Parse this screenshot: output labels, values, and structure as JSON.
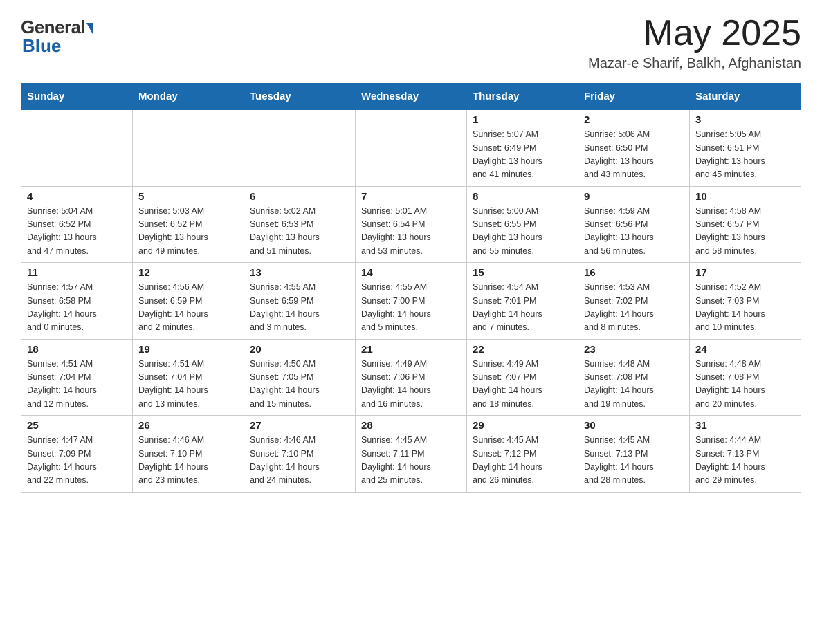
{
  "logo": {
    "general": "General",
    "blue": "Blue"
  },
  "header": {
    "month_year": "May 2025",
    "location": "Mazar-e Sharif, Balkh, Afghanistan"
  },
  "days_of_week": [
    "Sunday",
    "Monday",
    "Tuesday",
    "Wednesday",
    "Thursday",
    "Friday",
    "Saturday"
  ],
  "weeks": [
    [
      {
        "day": "",
        "info": ""
      },
      {
        "day": "",
        "info": ""
      },
      {
        "day": "",
        "info": ""
      },
      {
        "day": "",
        "info": ""
      },
      {
        "day": "1",
        "info": "Sunrise: 5:07 AM\nSunset: 6:49 PM\nDaylight: 13 hours\nand 41 minutes."
      },
      {
        "day": "2",
        "info": "Sunrise: 5:06 AM\nSunset: 6:50 PM\nDaylight: 13 hours\nand 43 minutes."
      },
      {
        "day": "3",
        "info": "Sunrise: 5:05 AM\nSunset: 6:51 PM\nDaylight: 13 hours\nand 45 minutes."
      }
    ],
    [
      {
        "day": "4",
        "info": "Sunrise: 5:04 AM\nSunset: 6:52 PM\nDaylight: 13 hours\nand 47 minutes."
      },
      {
        "day": "5",
        "info": "Sunrise: 5:03 AM\nSunset: 6:52 PM\nDaylight: 13 hours\nand 49 minutes."
      },
      {
        "day": "6",
        "info": "Sunrise: 5:02 AM\nSunset: 6:53 PM\nDaylight: 13 hours\nand 51 minutes."
      },
      {
        "day": "7",
        "info": "Sunrise: 5:01 AM\nSunset: 6:54 PM\nDaylight: 13 hours\nand 53 minutes."
      },
      {
        "day": "8",
        "info": "Sunrise: 5:00 AM\nSunset: 6:55 PM\nDaylight: 13 hours\nand 55 minutes."
      },
      {
        "day": "9",
        "info": "Sunrise: 4:59 AM\nSunset: 6:56 PM\nDaylight: 13 hours\nand 56 minutes."
      },
      {
        "day": "10",
        "info": "Sunrise: 4:58 AM\nSunset: 6:57 PM\nDaylight: 13 hours\nand 58 minutes."
      }
    ],
    [
      {
        "day": "11",
        "info": "Sunrise: 4:57 AM\nSunset: 6:58 PM\nDaylight: 14 hours\nand 0 minutes."
      },
      {
        "day": "12",
        "info": "Sunrise: 4:56 AM\nSunset: 6:59 PM\nDaylight: 14 hours\nand 2 minutes."
      },
      {
        "day": "13",
        "info": "Sunrise: 4:55 AM\nSunset: 6:59 PM\nDaylight: 14 hours\nand 3 minutes."
      },
      {
        "day": "14",
        "info": "Sunrise: 4:55 AM\nSunset: 7:00 PM\nDaylight: 14 hours\nand 5 minutes."
      },
      {
        "day": "15",
        "info": "Sunrise: 4:54 AM\nSunset: 7:01 PM\nDaylight: 14 hours\nand 7 minutes."
      },
      {
        "day": "16",
        "info": "Sunrise: 4:53 AM\nSunset: 7:02 PM\nDaylight: 14 hours\nand 8 minutes."
      },
      {
        "day": "17",
        "info": "Sunrise: 4:52 AM\nSunset: 7:03 PM\nDaylight: 14 hours\nand 10 minutes."
      }
    ],
    [
      {
        "day": "18",
        "info": "Sunrise: 4:51 AM\nSunset: 7:04 PM\nDaylight: 14 hours\nand 12 minutes."
      },
      {
        "day": "19",
        "info": "Sunrise: 4:51 AM\nSunset: 7:04 PM\nDaylight: 14 hours\nand 13 minutes."
      },
      {
        "day": "20",
        "info": "Sunrise: 4:50 AM\nSunset: 7:05 PM\nDaylight: 14 hours\nand 15 minutes."
      },
      {
        "day": "21",
        "info": "Sunrise: 4:49 AM\nSunset: 7:06 PM\nDaylight: 14 hours\nand 16 minutes."
      },
      {
        "day": "22",
        "info": "Sunrise: 4:49 AM\nSunset: 7:07 PM\nDaylight: 14 hours\nand 18 minutes."
      },
      {
        "day": "23",
        "info": "Sunrise: 4:48 AM\nSunset: 7:08 PM\nDaylight: 14 hours\nand 19 minutes."
      },
      {
        "day": "24",
        "info": "Sunrise: 4:48 AM\nSunset: 7:08 PM\nDaylight: 14 hours\nand 20 minutes."
      }
    ],
    [
      {
        "day": "25",
        "info": "Sunrise: 4:47 AM\nSunset: 7:09 PM\nDaylight: 14 hours\nand 22 minutes."
      },
      {
        "day": "26",
        "info": "Sunrise: 4:46 AM\nSunset: 7:10 PM\nDaylight: 14 hours\nand 23 minutes."
      },
      {
        "day": "27",
        "info": "Sunrise: 4:46 AM\nSunset: 7:10 PM\nDaylight: 14 hours\nand 24 minutes."
      },
      {
        "day": "28",
        "info": "Sunrise: 4:45 AM\nSunset: 7:11 PM\nDaylight: 14 hours\nand 25 minutes."
      },
      {
        "day": "29",
        "info": "Sunrise: 4:45 AM\nSunset: 7:12 PM\nDaylight: 14 hours\nand 26 minutes."
      },
      {
        "day": "30",
        "info": "Sunrise: 4:45 AM\nSunset: 7:13 PM\nDaylight: 14 hours\nand 28 minutes."
      },
      {
        "day": "31",
        "info": "Sunrise: 4:44 AM\nSunset: 7:13 PM\nDaylight: 14 hours\nand 29 minutes."
      }
    ]
  ]
}
